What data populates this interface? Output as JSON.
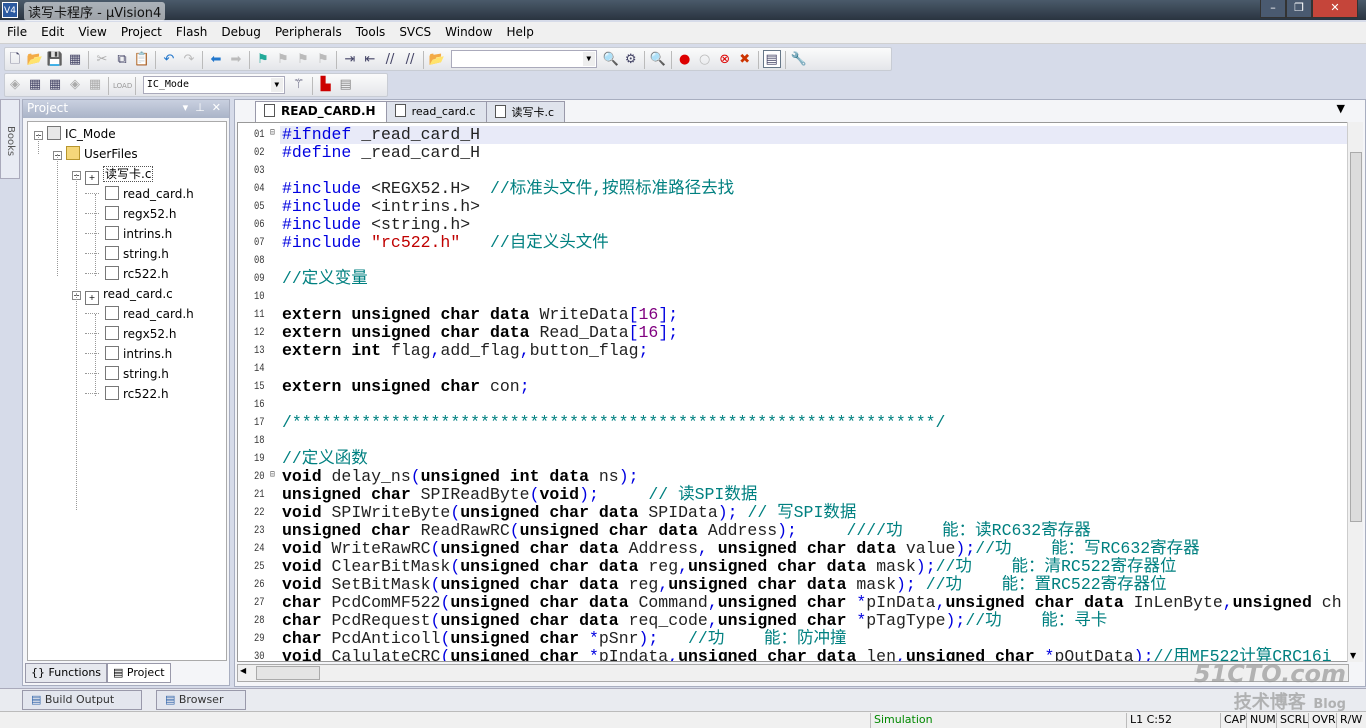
{
  "window": {
    "title": "读写卡程序 - µVision4",
    "logo": "V4"
  },
  "menu": [
    "File",
    "Edit",
    "View",
    "Project",
    "Flash",
    "Debug",
    "Peripherals",
    "Tools",
    "SVCS",
    "Window",
    "Help"
  ],
  "toolbar2": {
    "target": "IC_Mode",
    "load_label": "LOAD"
  },
  "books_tab": "Books",
  "project": {
    "title": "Project",
    "tree": [
      {
        "label": "IC_Mode",
        "level": 0,
        "type": "target",
        "expanded": true
      },
      {
        "label": "UserFiles",
        "level": 1,
        "type": "folder",
        "expanded": true
      },
      {
        "label": "读写卡.c",
        "level": 2,
        "type": "cfile",
        "expanded": true
      },
      {
        "label": "read_card.h",
        "level": 3,
        "type": "hfile"
      },
      {
        "label": "regx52.h",
        "level": 3,
        "type": "hfile"
      },
      {
        "label": "intrins.h",
        "level": 3,
        "type": "hfile"
      },
      {
        "label": "string.h",
        "level": 3,
        "type": "hfile"
      },
      {
        "label": "rc522.h",
        "level": 3,
        "type": "hfile"
      },
      {
        "label": "read_card.c",
        "level": 2,
        "type": "cfile",
        "expanded": true
      },
      {
        "label": "read_card.h",
        "level": 3,
        "type": "hfile"
      },
      {
        "label": "regx52.h",
        "level": 3,
        "type": "hfile"
      },
      {
        "label": "intrins.h",
        "level": 3,
        "type": "hfile"
      },
      {
        "label": "string.h",
        "level": 3,
        "type": "hfile"
      },
      {
        "label": "rc522.h",
        "level": 3,
        "type": "hfile"
      }
    ],
    "tabs": [
      {
        "label": "Functions",
        "active": false
      },
      {
        "label": "Project",
        "active": true
      }
    ]
  },
  "editor": {
    "tabs": [
      {
        "label": "READ_CARD.H",
        "active": true
      },
      {
        "label": "read_card.c",
        "active": false
      },
      {
        "label": "读写卡.c",
        "active": false
      }
    ],
    "current_line": 1,
    "lines": [
      "#ifndef _read_card_H",
      "#define _read_card_H",
      "",
      "#include <REGX52.H>  //标准头文件,按照标准路径去找",
      "#include <intrins.h>",
      "#include <string.h>",
      "#include \"rc522.h\"   //自定义头文件",
      "",
      "//定义变量",
      "",
      "extern unsigned char data WriteData[16];",
      "extern unsigned char data Read_Data[16];",
      "extern int flag,add_flag,button_flag;",
      "",
      "extern unsigned char con;",
      "",
      "/*****************************************************************/",
      "",
      "//定义函数",
      "void delay_ns(unsigned int data ns);",
      "unsigned char SPIReadByte(void);     // 读SPI数据",
      "void SPIWriteByte(unsigned char data SPIData); // 写SPI数据",
      "unsigned char ReadRawRC(unsigned char data Address);     ////功    能：读RC632寄存器",
      "void WriteRawRC(unsigned char data Address, unsigned char data value);//功    能：写RC632寄存器",
      "void ClearBitMask(unsigned char data reg,unsigned char data mask);//功    能：清RC522寄存器位",
      "void SetBitMask(unsigned char data reg,unsigned char data mask); //功    能：置RC522寄存器位",
      "char PcdComMF522(unsigned char data Command,unsigned char *pInData,unsigned char data InLenByte,unsigned ch",
      "char PcdRequest(unsigned char data req_code,unsigned char *pTagType);//功    能：寻卡",
      "char PcdAnticoll(unsigned char *pSnr);   //功    能：防冲撞",
      "void CalulateCRC(unsigned char *pIndata,unsigned char data len,unsigned char *pOutData);//用MF522计算CRC16i"
    ]
  },
  "bottom_tabs": [
    "Build Output",
    "Browser"
  ],
  "status": {
    "mode": "Simulation",
    "position": "L1 C:52",
    "indicators": [
      "CAP",
      "NUM",
      "SCRL",
      "OVR",
      "R/W"
    ]
  },
  "watermark": {
    "site": "51CTO.com",
    "sub": "技术博客",
    "blog": "Blog"
  }
}
